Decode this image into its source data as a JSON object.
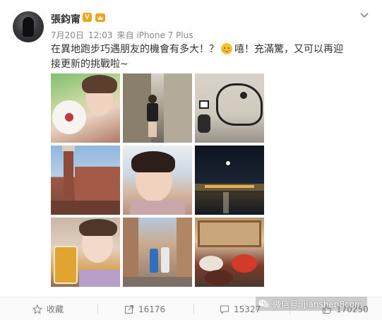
{
  "user": {
    "name": "張鈞甯",
    "verified_badge": "V"
  },
  "meta": {
    "date": "7月20日",
    "time": "12:03",
    "source": "来自 iPhone 7 Plus"
  },
  "post": {
    "text_part1": "在異地跑步巧遇朋友的機會有多大！？",
    "text_part2": "嘻！充滿驚，又可以再迎接更新的挑戰啦~"
  },
  "images": [
    {
      "name": "photo-flower-selfie"
    },
    {
      "name": "photo-street-walk"
    },
    {
      "name": "photo-graffiti-wall"
    },
    {
      "name": "photo-siena-tower"
    },
    {
      "name": "photo-selfie-sky"
    },
    {
      "name": "photo-night-river"
    },
    {
      "name": "photo-beer-selfie"
    },
    {
      "name": "photo-street-friends"
    },
    {
      "name": "photo-food-table"
    }
  ],
  "actions": {
    "favorite_label": "收藏",
    "share_count": "16176",
    "comment_count": "15327",
    "like_count": "170250"
  },
  "watermark": {
    "text": "微信号: jianshen8com"
  },
  "colors": {
    "badge": "#f0a518",
    "text": "#333333",
    "muted": "#888888"
  }
}
